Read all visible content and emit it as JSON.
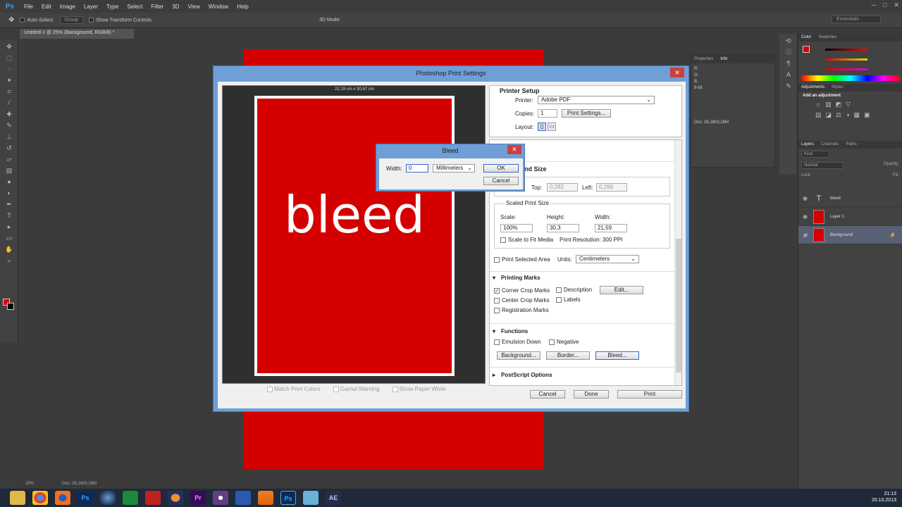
{
  "menubar": {
    "logo": "Ps",
    "items": [
      "File",
      "Edit",
      "Image",
      "Layer",
      "Type",
      "Select",
      "Filter",
      "3D",
      "View",
      "Window",
      "Help"
    ]
  },
  "options": {
    "auto_select": "Auto-Select:",
    "group": "Group",
    "show_transform": "Show Transform Controls",
    "mode3d": "3D Mode:",
    "workspace": "Essentials"
  },
  "doc_tab": "Untitled-1 @ 25% (Background, RGB/8) *",
  "status": {
    "zoom": "25%",
    "doc": "Doc: 26,1M/3,26M"
  },
  "print_dialog": {
    "title": "Photoshop Print Settings",
    "preview_dim": "22,19 cm x 30,87 cm",
    "canvas_text": "bleed",
    "match_print_colors": "Match Print Colors",
    "gamut_warning": "Gamut Warning",
    "show_paper_white": "Show Paper White",
    "printer_setup": "Printer Setup",
    "printer_label": "Printer:",
    "printer_value": "Adobe PDF",
    "copies_label": "Copies:",
    "copies_value": "1",
    "print_settings_btn": "Print Settings...",
    "layout_label": "Layout:",
    "position_size": "Position and Size",
    "top_label": "Top:",
    "top_value": "0,282",
    "left_label": "Left:",
    "left_value": "0,299",
    "scaled_print_size": "Scaled Print Size",
    "scale_label": "Scale:",
    "scale_value": "100%",
    "height_label": "Height:",
    "height_value": "30,3",
    "width_label": "Width:",
    "width_value": "21,59",
    "scale_to_fit": "Scale to Fit Media",
    "print_resolution": "Print Resolution: 300 PPI",
    "print_selected_area": "Print Selected Area",
    "units_label": "Units:",
    "units_value": "Centimeters",
    "printing_marks": "Printing Marks",
    "corner_crop": "Corner Crop Marks",
    "center_crop": "Center Crop Marks",
    "registration": "Registration Marks",
    "description": "Description",
    "labels": "Labels",
    "edit_btn": "Edit...",
    "functions": "Functions",
    "emulsion_down": "Emulsion Down",
    "negative": "Negative",
    "background_btn": "Background...",
    "border_btn": "Border...",
    "bleed_btn": "Bleed...",
    "postscript": "PostScript Options",
    "cancel": "Cancel",
    "done": "Done",
    "print": "Print"
  },
  "bleed_dialog": {
    "title": "Bleed",
    "width_label": "Width:",
    "width_value": "0",
    "unit": "Millimeters",
    "ok": "OK",
    "cancel": "Cancel"
  },
  "panels": {
    "color_tabs": [
      "Color",
      "Swatches"
    ],
    "info_tabs": [
      "Properties",
      "Info"
    ],
    "adjust_tabs": [
      "Adjustments",
      "Styles"
    ],
    "add_adjustment": "Add an adjustment",
    "layers_tabs": [
      "Layers",
      "Channels",
      "Paths"
    ],
    "kind": "Kind",
    "blend": "Normal",
    "opacity": "Opacity:",
    "lock": "Lock:",
    "fill": "Fill:",
    "info_rows": [
      "R:",
      "G:",
      "B:",
      "8-bit"
    ],
    "info_doc": "Doc: 26,1M/3,26M",
    "layers": [
      {
        "name": "bleed",
        "type": "text"
      },
      {
        "name": "Layer 1",
        "type": "fill"
      },
      {
        "name": "Background",
        "type": "fill"
      }
    ]
  },
  "clock": {
    "time": "21:13",
    "date": "20.10.2013"
  },
  "colors": {
    "accent_red": "#d40000",
    "dialog_blue": "#6f9fd6"
  }
}
